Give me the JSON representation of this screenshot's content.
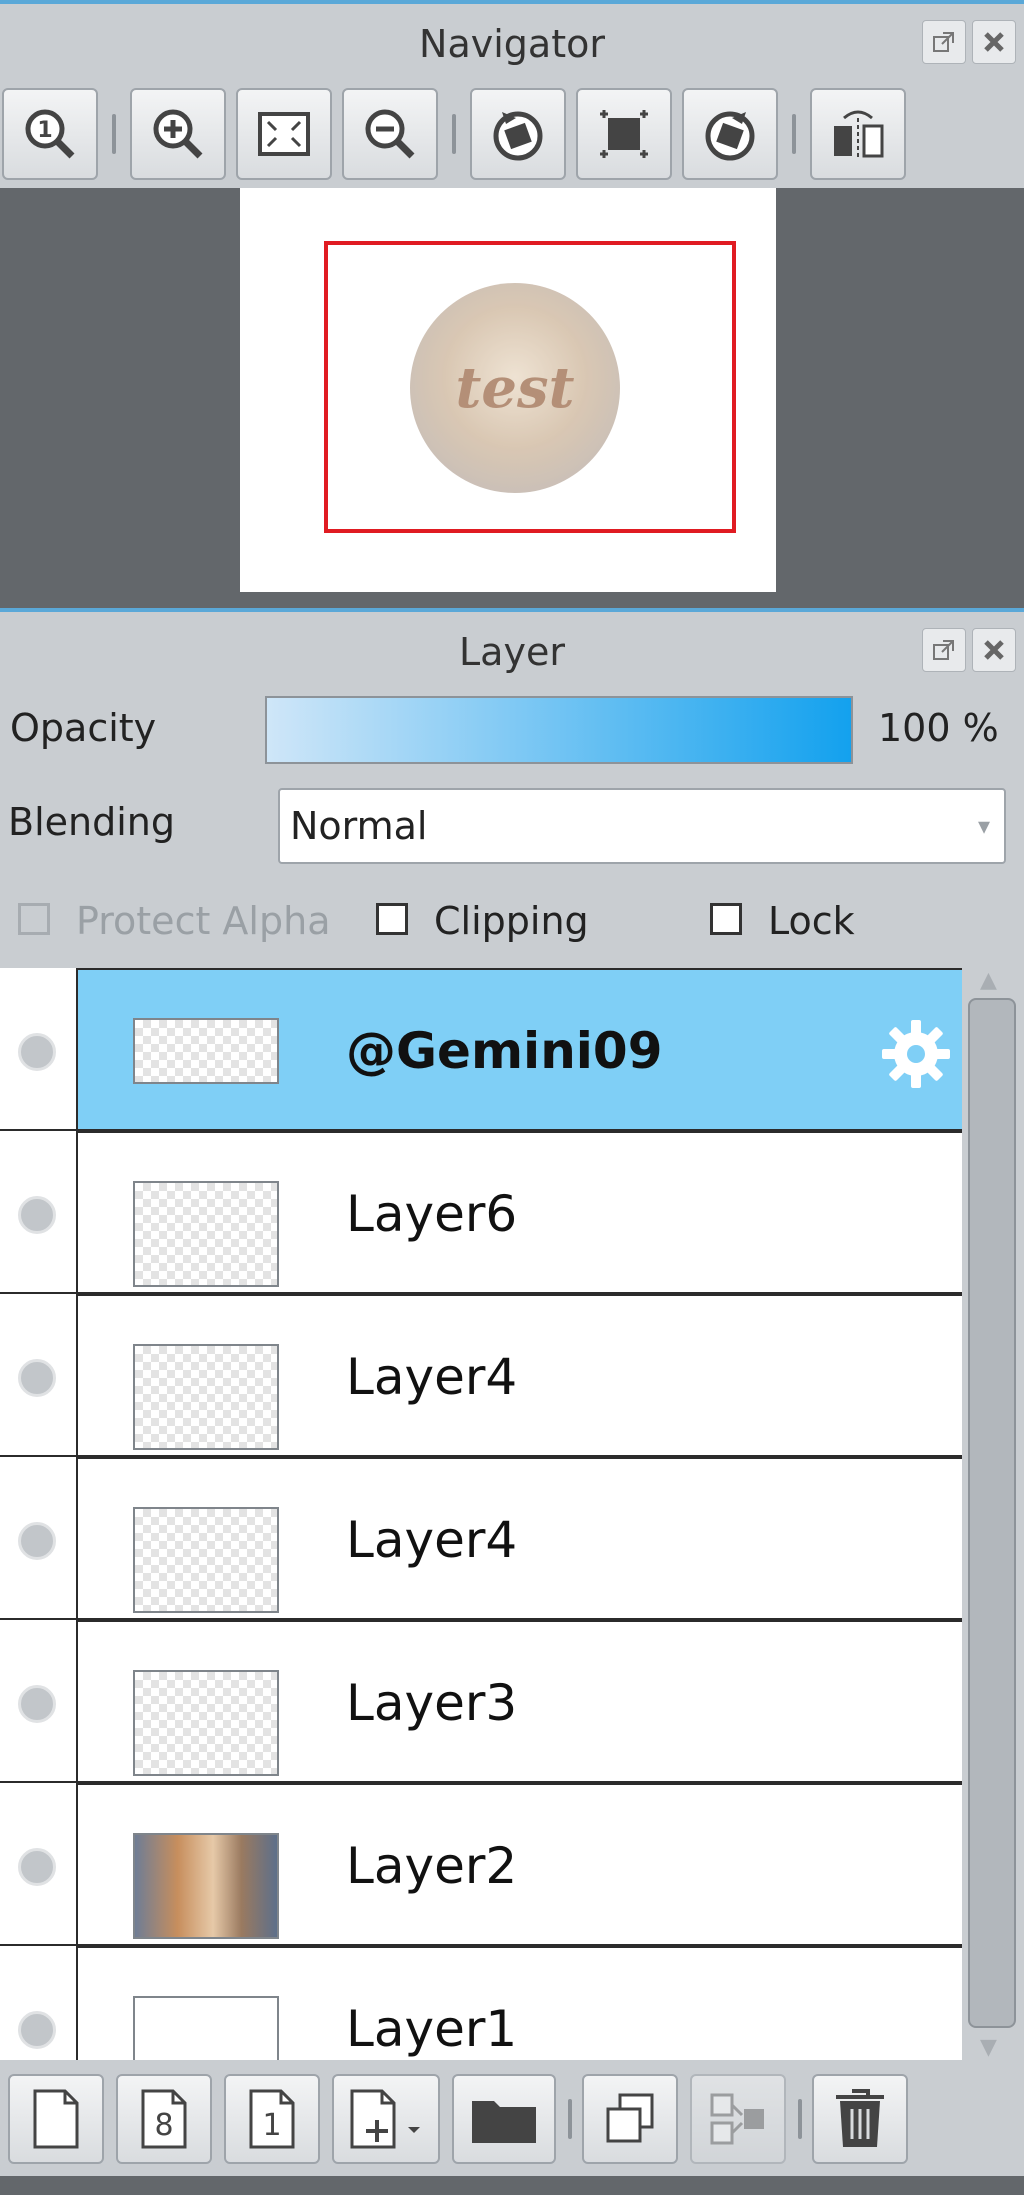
{
  "navigator": {
    "title": "Navigator",
    "thumb_text": "test"
  },
  "layer_panel": {
    "title": "Layer",
    "opacity_label": "Opacity",
    "opacity_value": "100 %",
    "opacity_fraction": 1.0,
    "blending_label": "Blending",
    "blending_value": "Normal",
    "protect_alpha_label": "Protect Alpha",
    "clipping_label": "Clipping",
    "lock_label": "Lock",
    "selected_color": "#7fcff6",
    "layers": [
      {
        "name": "@Gemini09",
        "selected": true
      },
      {
        "name": "Layer6"
      },
      {
        "name": "Layer4"
      },
      {
        "name": "Layer4"
      },
      {
        "name": "Layer3"
      },
      {
        "name": "Layer2"
      },
      {
        "name": "Layer1"
      }
    ]
  },
  "bottom_toolbar": {
    "icons": [
      "new-layer-icon",
      "new-8bit-layer-icon",
      "new-1bit-layer-icon",
      "add-layer-menu-icon",
      "folder-icon",
      "duplicate-icon",
      "merge-down-icon",
      "delete-icon"
    ],
    "btn_8_label": "8",
    "btn_1_label": "1"
  }
}
